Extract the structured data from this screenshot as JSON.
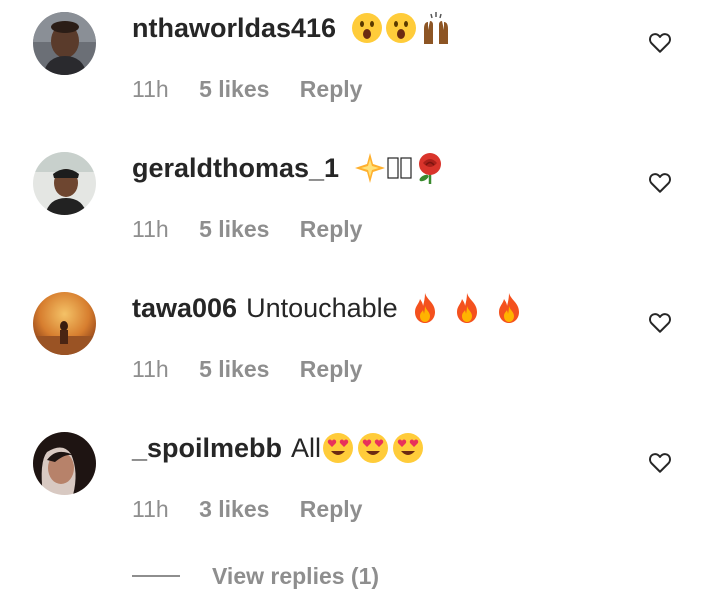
{
  "comments": [
    {
      "username": "nthaworldas416",
      "text": "",
      "emojis": [
        "face-open-mouth-icon",
        "face-open-mouth-icon",
        "raised-hands-icon"
      ],
      "time": "11h",
      "likes": "5 likes",
      "reply": "Reply"
    },
    {
      "username": "geraldthomas_1",
      "text": "",
      "emojis": [
        "sparkle-star-icon",
        "missing-glyph-icon",
        "missing-glyph-icon",
        "rose-icon"
      ],
      "time": "11h",
      "likes": "5 likes",
      "reply": "Reply"
    },
    {
      "username": "tawa006",
      "text": "Untouchable",
      "emojis": [
        "fire-icon",
        "fire-icon",
        "fire-icon"
      ],
      "time": "11h",
      "likes": "5 likes",
      "reply": "Reply"
    },
    {
      "username": "_spoilmebb",
      "text": "All",
      "emojis": [
        "heart-eyes-face-icon",
        "heart-eyes-face-icon",
        "heart-eyes-face-icon"
      ],
      "time": "11h",
      "likes": "3 likes",
      "reply": "Reply"
    }
  ],
  "view_replies": "View replies (1)",
  "colors": {
    "text": "#262626",
    "secondary": "#8e8e8e",
    "background": "#ffffff"
  }
}
